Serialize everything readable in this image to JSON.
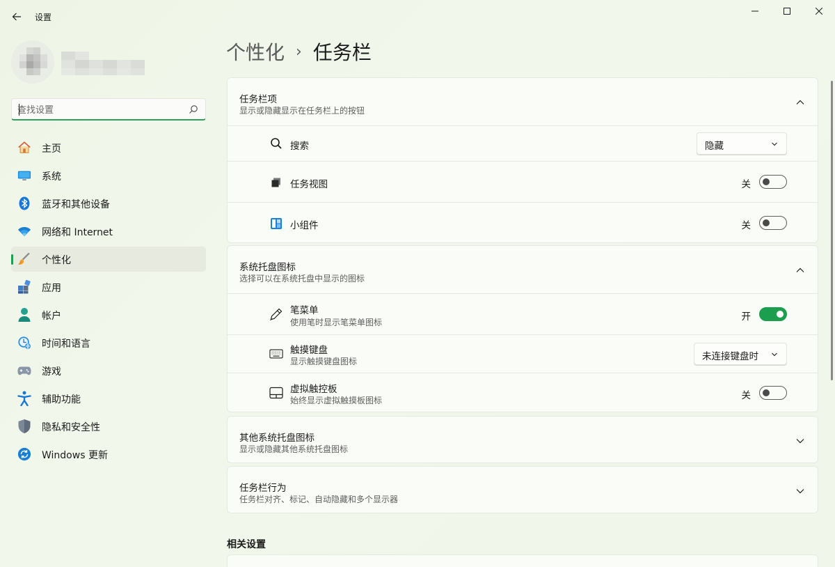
{
  "window": {
    "title": "设置"
  },
  "search": {
    "placeholder": "查找设置"
  },
  "sidebar": {
    "items": [
      {
        "label": "主页",
        "icon": "home-icon",
        "active": false
      },
      {
        "label": "系统",
        "icon": "system-icon",
        "active": false
      },
      {
        "label": "蓝牙和其他设备",
        "icon": "bluetooth-icon",
        "active": false
      },
      {
        "label": "网络和 Internet",
        "icon": "wifi-icon",
        "active": false
      },
      {
        "label": "个性化",
        "icon": "brush-icon",
        "active": true
      },
      {
        "label": "应用",
        "icon": "apps-icon",
        "active": false
      },
      {
        "label": "帐户",
        "icon": "account-icon",
        "active": false
      },
      {
        "label": "时间和语言",
        "icon": "time-language-icon",
        "active": false
      },
      {
        "label": "游戏",
        "icon": "gamepad-icon",
        "active": false
      },
      {
        "label": "辅助功能",
        "icon": "accessibility-icon",
        "active": false
      },
      {
        "label": "隐私和安全性",
        "icon": "shield-icon",
        "active": false
      },
      {
        "label": "Windows 更新",
        "icon": "windows-update-icon",
        "active": false
      }
    ]
  },
  "header": {
    "parent": "个性化",
    "separator": "›",
    "current": "任务栏"
  },
  "sections": {
    "taskbar_items": {
      "title": "任务栏项",
      "subtitle": "显示或隐藏显示在任务栏上的按钮",
      "expanded": true,
      "search": {
        "label": "搜索",
        "value": "隐藏"
      },
      "task_view": {
        "label": "任务视图",
        "state": "关",
        "on": false
      },
      "widgets": {
        "label": "小组件",
        "state": "关",
        "on": false
      }
    },
    "system_tray": {
      "title": "系统托盘图标",
      "subtitle": "选择可以在系统托盘中显示的图标",
      "expanded": true,
      "pen_menu": {
        "label": "笔菜单",
        "desc": "使用笔时显示笔菜单图标",
        "state": "开",
        "on": true
      },
      "touch_keyboard": {
        "label": "触摸键盘",
        "desc": "显示触摸键盘图标",
        "value": "未连接键盘时"
      },
      "virtual_touchpad": {
        "label": "虚拟触控板",
        "desc": "始终显示虚拟触摸板图标",
        "state": "关",
        "on": false
      }
    },
    "other_tray": {
      "title": "其他系统托盘图标",
      "subtitle": "显示或隐藏其他系统托盘图标"
    },
    "taskbar_behavior": {
      "title": "任务栏行为",
      "subtitle": "任务栏对齐、标记、自动隐藏和多个显示器"
    }
  },
  "related": {
    "title": "相关设置"
  },
  "colors": {
    "accent": "#1c9e4f"
  }
}
